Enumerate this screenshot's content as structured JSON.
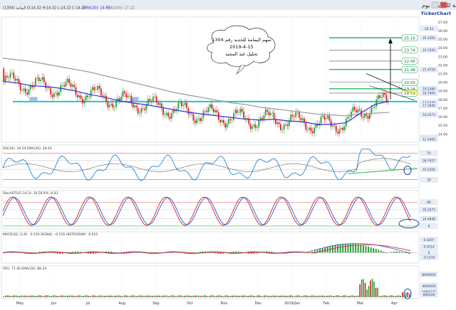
{
  "header": {
    "title": "اليمامة للحديد - يوم",
    "info_line": "اليمامة (1304)  O:14.32  H:14.32  L:14.22  C:14.22",
    "ema_label": "EMA(20): 14.63",
    "ma_label": "MA(200): 17.22"
  },
  "brand": "TickerChart",
  "callout": {
    "line1": "سهم اليمامة للحديد رقم 1304",
    "line2": "2019-4-15",
    "line3": "تحليل عبد المجيد"
  },
  "colors": {
    "bull": "#2e9c3a",
    "bear": "#d92020",
    "ema": "#2d2ddc",
    "ma200": "#9aa0a8",
    "cyan": "#23c6c6",
    "green_level": "#28b46a",
    "axis_label_bg": "#e8eef7"
  },
  "chart_data": [
    {
      "type": "candlestick",
      "panel": "price",
      "x_labels": [
        "May",
        "Jun",
        "Jul",
        "Aug",
        "Sep",
        "Oct",
        "Nov",
        "Dec",
        "2019/Jan",
        "Feb",
        "Mar",
        "Apr"
      ],
      "y_ticks": [
        14.0,
        15.0,
        16.0,
        17.0,
        18.0,
        19.0,
        20.0,
        21.0,
        22.0,
        23.0,
        24.0,
        25.0,
        26.0,
        27.0
      ],
      "ylim": [
        13.2,
        27.4
      ],
      "target_levels": [
        25.16,
        23.74,
        22.45,
        21.48,
        20.0,
        19.24,
        18.74
      ],
      "support_level": 17.75,
      "side_labels": [
        "26.24",
        "25.1565",
        "23.7430",
        "21.4759",
        "19.2380",
        "18.7400",
        "17.6446",
        "17.3040",
        "16.2573",
        "13.5700",
        "12.5400"
      ],
      "series": [
        {
          "name": "EMA(20)",
          "values": [
            20.1,
            19.9,
            19.6,
            19.5,
            19.3,
            19.0,
            18.6,
            18.3,
            17.9,
            17.6,
            17.4,
            17.1,
            16.8,
            16.5,
            16.3,
            16.1,
            15.9,
            15.7,
            15.6,
            15.7,
            15.5,
            15.4,
            15.1,
            15.1,
            15.3,
            16.4,
            17.4,
            17.8
          ]
        },
        {
          "name": "MA(200)",
          "values": [
            22.8,
            22.6,
            22.4,
            22.1,
            21.8,
            21.5,
            21.2,
            20.8,
            20.4,
            20.0,
            19.6,
            19.2,
            18.8,
            18.5,
            18.2,
            17.9,
            17.6,
            17.4,
            17.1,
            16.9,
            16.7,
            16.5,
            16.3,
            16.2,
            16.1,
            16.3,
            16.4,
            16.5
          ]
        }
      ]
    },
    {
      "type": "line",
      "panel": "RSI(14)",
      "legend": "RSI(14): 38.54   EMA(20): 39.43",
      "y_ticks": [
        70.0,
        58.7427,
        45.5356,
        30.0
      ],
      "ylim": [
        20,
        80
      ]
    },
    {
      "type": "line",
      "panel": "StochRSI",
      "legend": "StochSTO(5,14,3): 16.58   K%: 8.83",
      "y_ticks": [
        80.0,
        55.2573,
        24.4948,
        0.0
      ],
      "ylim": [
        -5,
        100
      ]
    },
    {
      "type": "bar",
      "panel": "MACD(26,12,9)",
      "legend": "MACD(26,12,9): -0.159   SIGNAL: -0.159   HISTOGRAM: -0.012",
      "y_ticks": [
        0.4207,
        0.2014,
        0.0,
        -0.1514
      ],
      "ylim": [
        -0.3,
        0.5
      ]
    },
    {
      "type": "bar",
      "panel": "VOL",
      "legend": "VOL: 71.48   EMA(20): 88.34",
      "y_ticks": [
        8000000,
        4000000,
        1890227,
        890228
      ],
      "ylim": [
        0,
        9000000
      ]
    }
  ]
}
